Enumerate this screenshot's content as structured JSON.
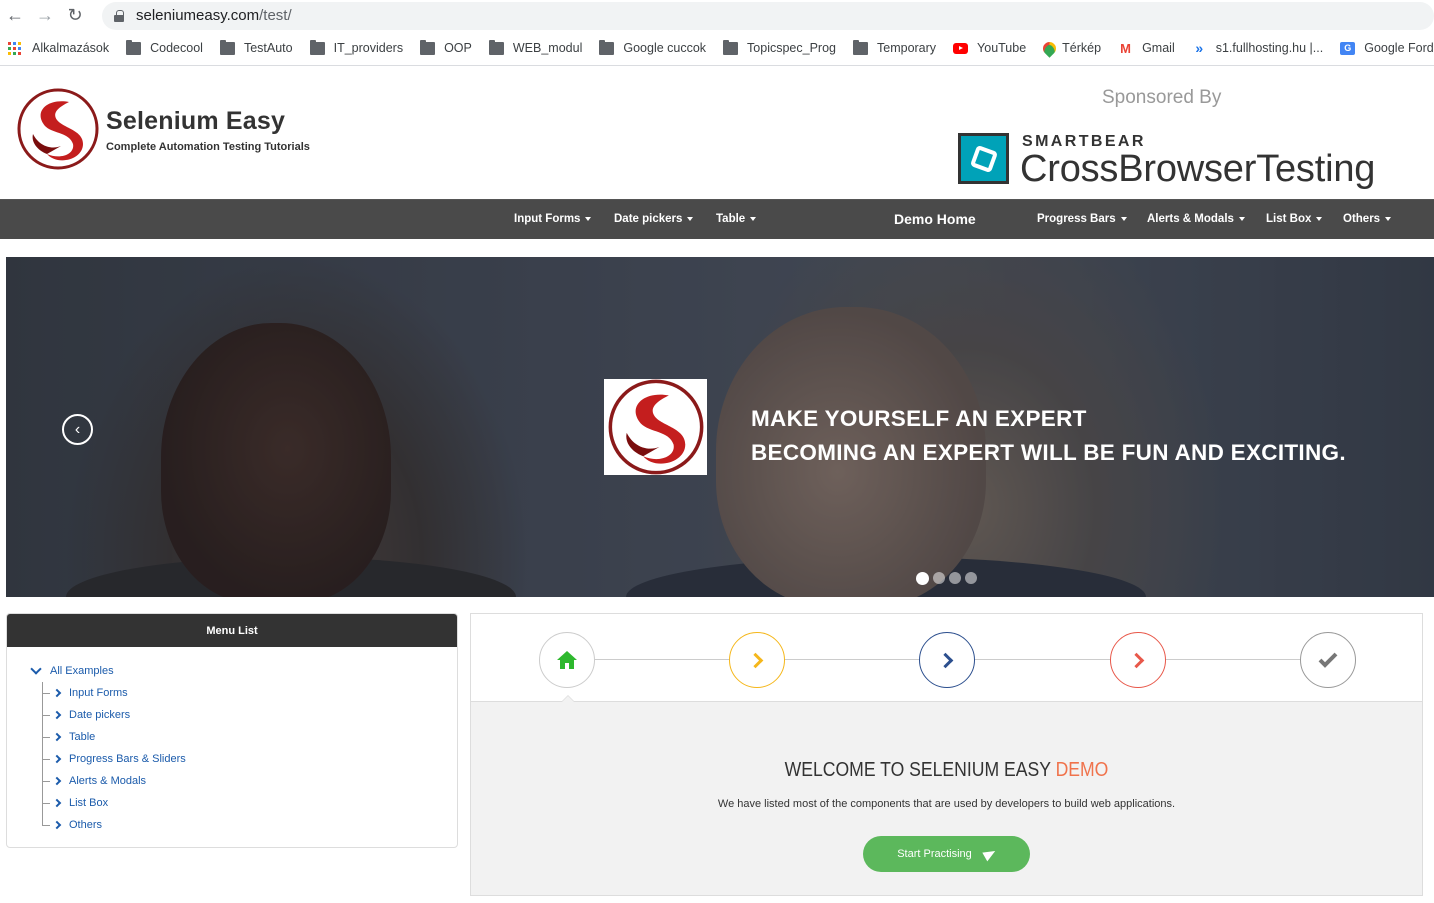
{
  "browser": {
    "url_host": "seleniumeasy.com",
    "url_path": "/test/",
    "bookmarks": [
      {
        "label": "Alkalmazások",
        "icon": "apps-icon"
      },
      {
        "label": "Codecool",
        "icon": "folder-icon"
      },
      {
        "label": "TestAuto",
        "icon": "folder-icon"
      },
      {
        "label": "IT_providers",
        "icon": "folder-icon"
      },
      {
        "label": "OOP",
        "icon": "folder-icon"
      },
      {
        "label": "WEB_modul",
        "icon": "folder-icon"
      },
      {
        "label": "Google cuccok",
        "icon": "folder-icon"
      },
      {
        "label": "Topicspec_Prog",
        "icon": "folder-icon"
      },
      {
        "label": "Temporary",
        "icon": "folder-icon"
      },
      {
        "label": "YouTube",
        "icon": "youtube-icon"
      },
      {
        "label": "Térkép",
        "icon": "maps-icon"
      },
      {
        "label": "Gmail",
        "icon": "gmail-icon"
      },
      {
        "label": "s1.fullhosting.hu |...",
        "icon": "fullhosting-icon"
      },
      {
        "label": "Google Fordító",
        "icon": "translate-icon"
      }
    ]
  },
  "header": {
    "brand_name": "Selenium Easy",
    "brand_tagline": "Complete Automation Testing Tutorials",
    "sponsored_label": "Sponsored By",
    "sponsor_small": "SMARTBEAR",
    "sponsor_big": "CrossBrowserTesting"
  },
  "nav": {
    "items": [
      "Input Forms",
      "Date pickers",
      "Table",
      "Progress Bars",
      "Alerts & Modals",
      "List Box",
      "Others"
    ],
    "home": "Demo Home"
  },
  "carousel": {
    "line1": "MAKE YOURSELF AN EXPERT",
    "line2": "BECOMING AN EXPERT WILL BE FUN AND EXCITING.",
    "slides": 4,
    "active_slide": 1
  },
  "menu": {
    "title": "Menu List",
    "root": "All Examples",
    "items": [
      "Input Forms",
      "Date pickers",
      "Table",
      "Progress Bars & Sliders",
      "Alerts & Modals",
      "List Box",
      "Others"
    ]
  },
  "welcome": {
    "title_main": "WELCOME TO SELENIUM EASY",
    "title_accent": "DEMO",
    "text": "We have listed most of the components that are used by developers to build web applications.",
    "button": "Start Practising",
    "step_colors": [
      "#2eb82e",
      "#f5b71b",
      "#2c4f8e",
      "#e8584a",
      "#777777"
    ]
  },
  "colors": {
    "accent": "#f0734c",
    "nav_bg": "#4a4a4a",
    "button_green": "#5cb85c",
    "link_blue": "#1b5bab"
  }
}
